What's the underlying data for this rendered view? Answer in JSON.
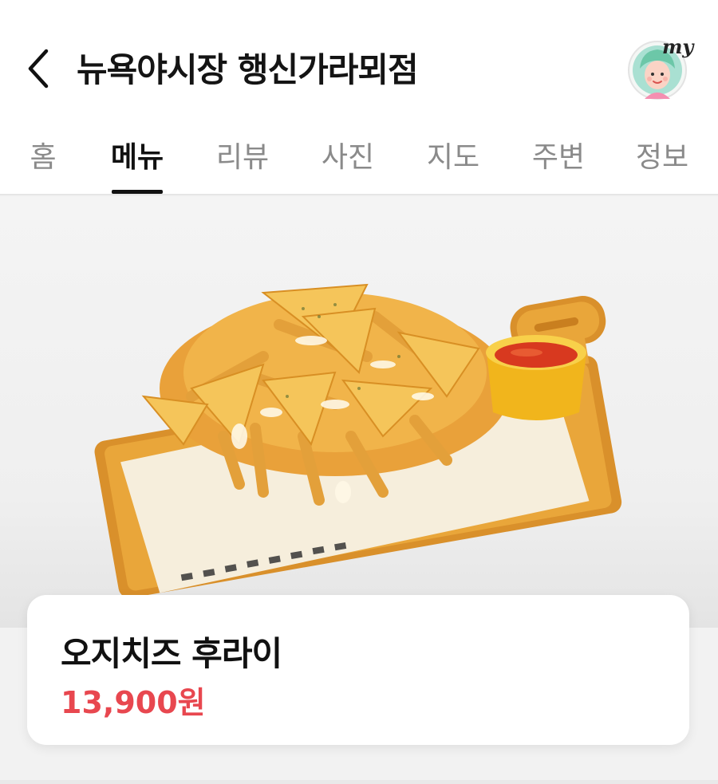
{
  "header": {
    "title": "뉴욕야시장 행신가라뫼점",
    "back_icon": "chevron-left-icon",
    "avatar_badge": "my"
  },
  "tabs": [
    {
      "label": "홈",
      "active": false
    },
    {
      "label": "메뉴",
      "active": true
    },
    {
      "label": "리뷰",
      "active": false
    },
    {
      "label": "사진",
      "active": false
    },
    {
      "label": "지도",
      "active": false
    },
    {
      "label": "주변",
      "active": false
    },
    {
      "label": "정보",
      "active": false
    }
  ],
  "menu_item": {
    "name": "오지치즈 후라이",
    "price": "13,900원",
    "price_color": "#e8474f"
  }
}
